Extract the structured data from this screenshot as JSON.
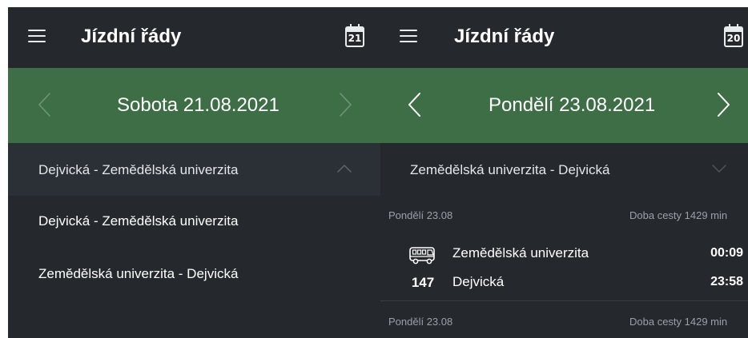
{
  "left": {
    "appbar": {
      "title": "Jízdní řády",
      "calendar_day": "21"
    },
    "date": {
      "label": "Sobota 21.08.2021"
    },
    "route_selector": {
      "label": "Dejvická - Zemědělská univerzita",
      "expanded": true
    },
    "menu_items": [
      {
        "label": "Dejvická - Zemědělská univerzita"
      },
      {
        "label": "Zemědělská univerzita - Dejvická"
      }
    ]
  },
  "right": {
    "appbar": {
      "title": "Jízdní řády",
      "calendar_day": "20"
    },
    "date": {
      "label": "Pondělí 23.08.2021"
    },
    "route_selector": {
      "label": "Zemědělská univerzita - Dejvická",
      "expanded": false
    },
    "connections": [
      {
        "day": "Pondělí 23.08",
        "duration": "Doba cesty 1429 min",
        "line": "147",
        "vehicle_icon": "bus-icon",
        "from": {
          "stop": "Zemědělská univerzita",
          "time": "00:09"
        },
        "to": {
          "stop": "Dejvická",
          "time": "23:58"
        }
      },
      {
        "day": "Pondělí 23.08",
        "duration": "Doba cesty 1429 min"
      }
    ]
  },
  "colors": {
    "background": "#25292e",
    "date_bar": "#3d6e45",
    "text_primary": "#ffffff",
    "text_secondary": "#9aa0a7"
  }
}
